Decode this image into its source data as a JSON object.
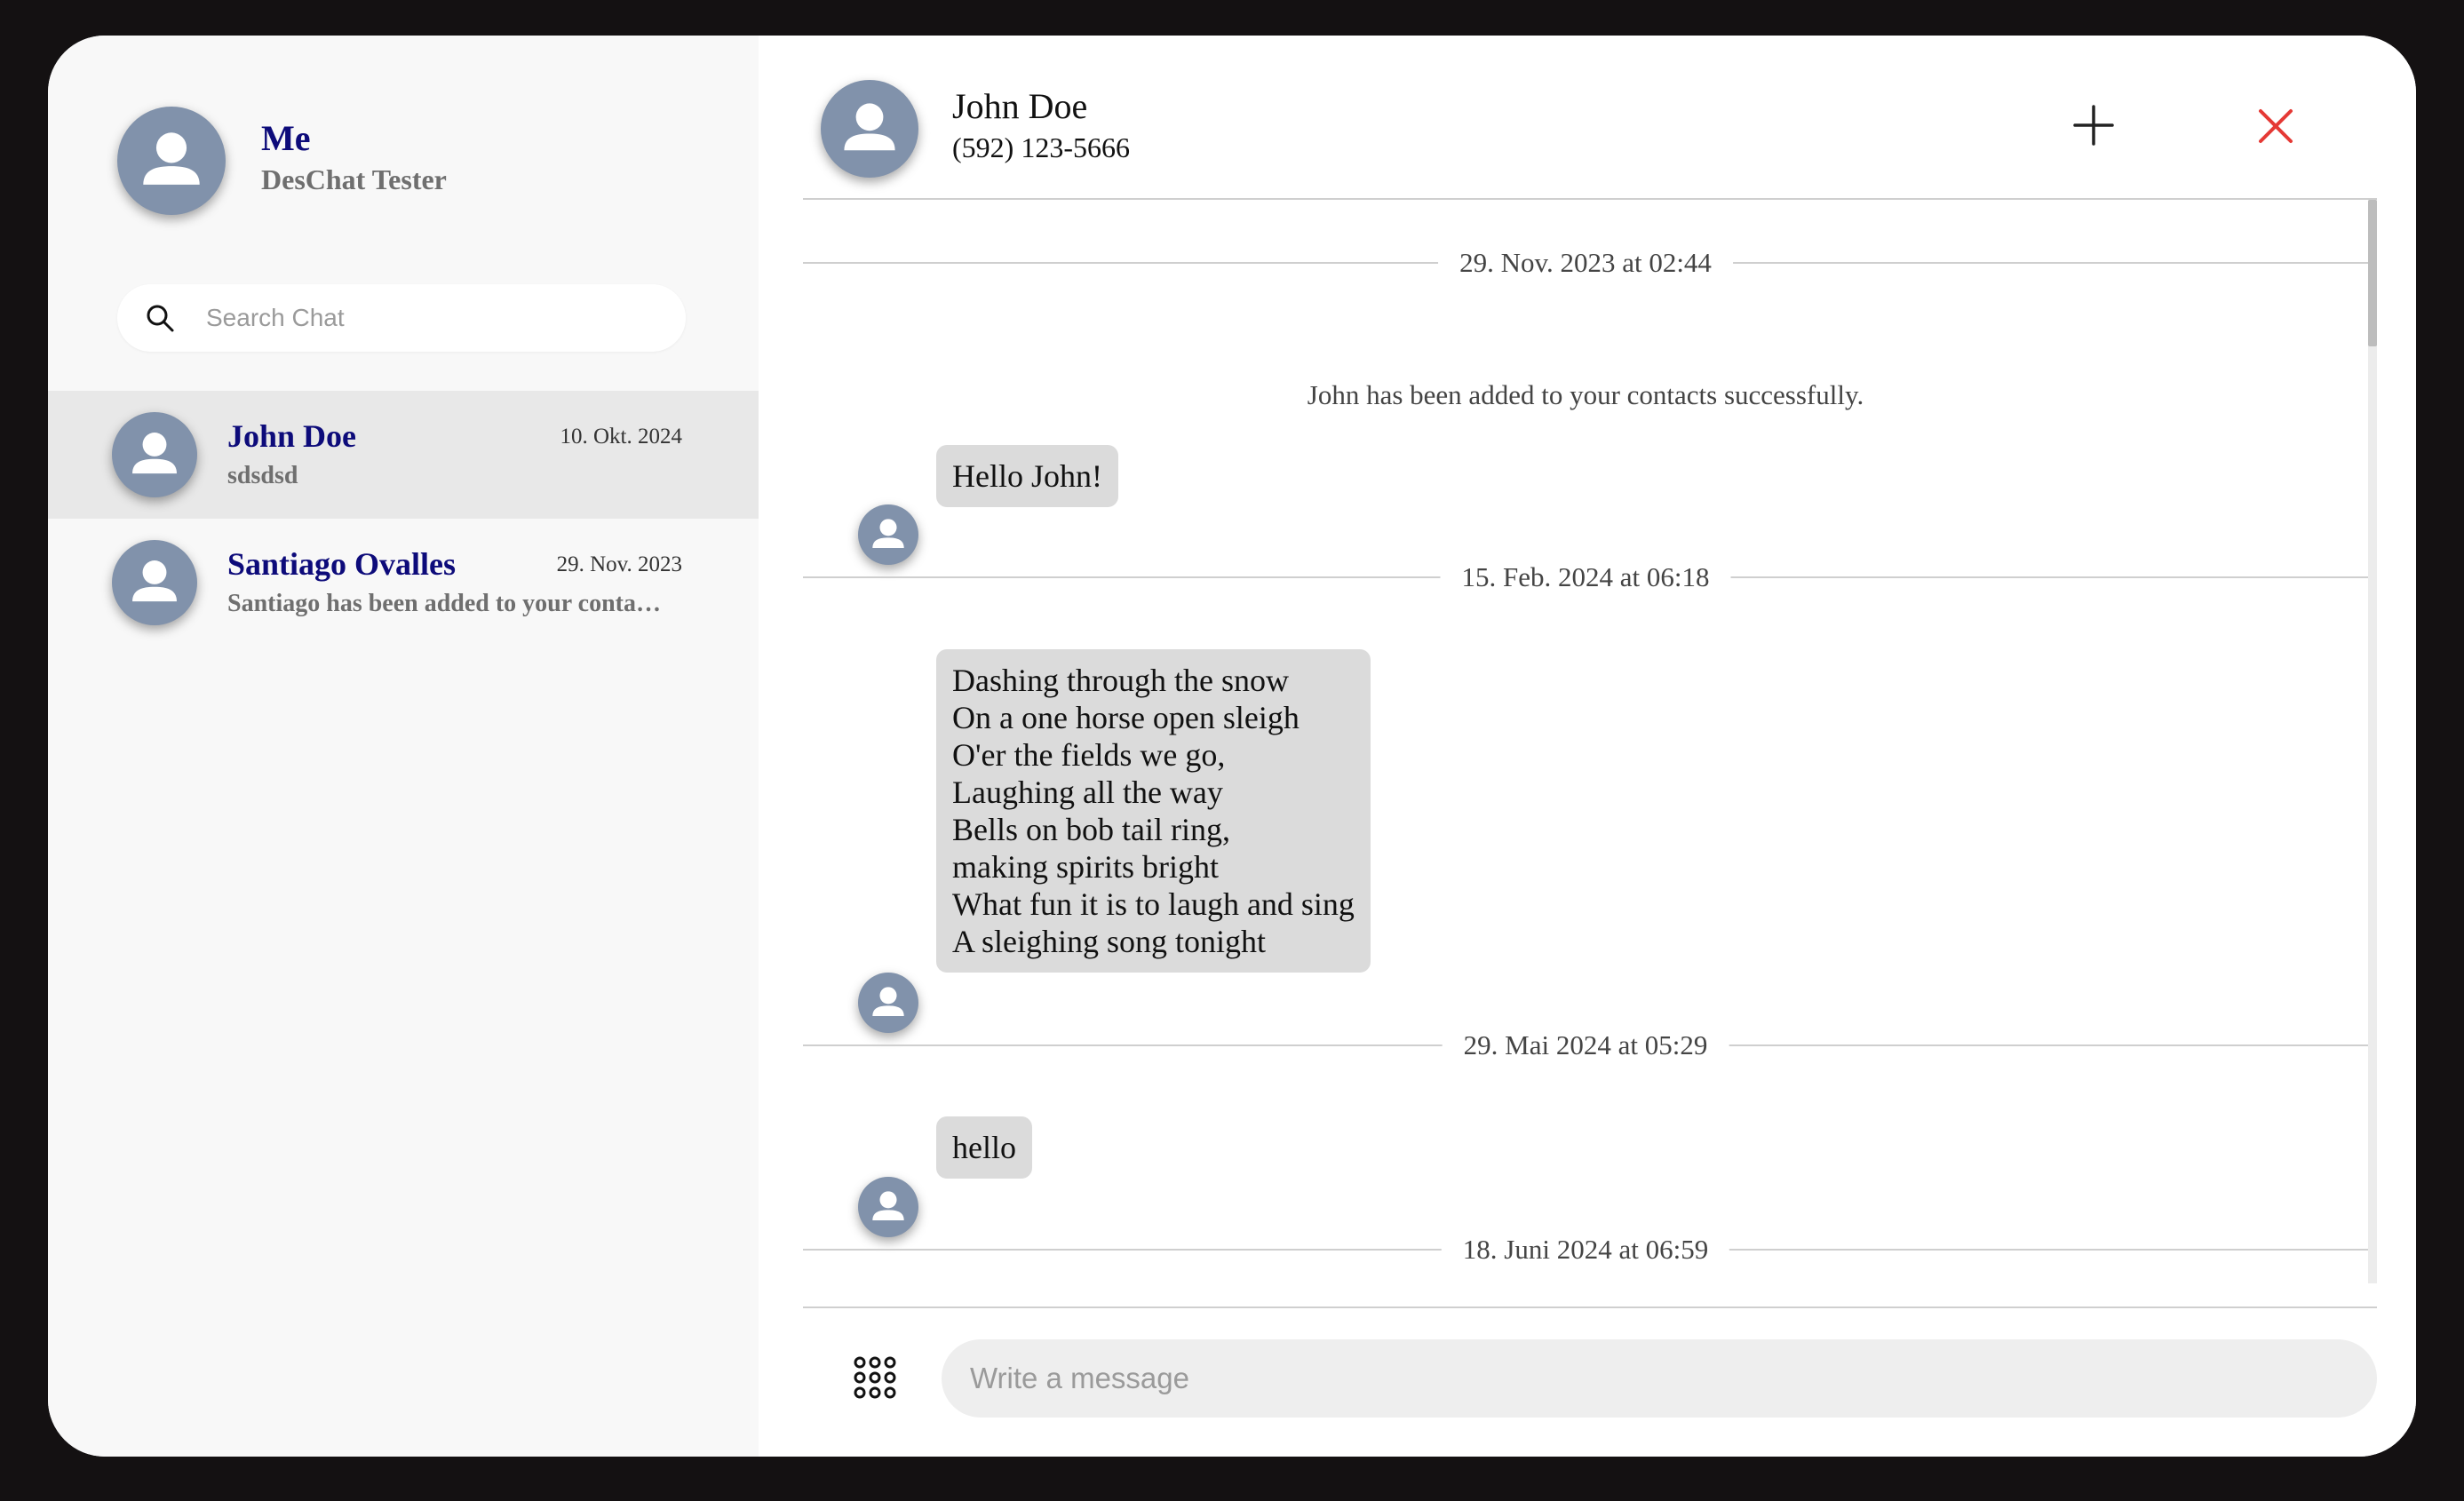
{
  "profile": {
    "name": "Me",
    "subtitle": "DesChat Tester",
    "avatar_icon": "user-icon"
  },
  "search": {
    "placeholder": "Search Chat",
    "icon": "search-icon"
  },
  "chats": [
    {
      "name": "John Doe",
      "date": "10. Okt. 2024",
      "preview": "sdsdsd",
      "active": true
    },
    {
      "name": "Santiago Ovalles",
      "date": "29. Nov. 2023",
      "preview": "Santiago has been added to your contacts successfully.",
      "active": false
    }
  ],
  "conversation": {
    "contact_name": "John Doe",
    "contact_phone": "(592) 123-5666",
    "actions": {
      "add_icon": "plus-icon",
      "close_icon": "close-icon"
    },
    "timeline": [
      {
        "type": "date",
        "label": "29. Nov. 2023 at 02:44"
      },
      {
        "type": "system",
        "text": "John has been added to your contacts successfully."
      },
      {
        "type": "message",
        "text": "Hello John!"
      },
      {
        "type": "date",
        "label": "15. Feb. 2024 at 06:18"
      },
      {
        "type": "message",
        "text": "Dashing through the snow\nOn a one horse open sleigh\nO'er the fields we go,\nLaughing all the way\nBells on bob tail ring,\nmaking spirits bright\nWhat fun it is to laugh and sing\nA sleighing song tonight"
      },
      {
        "type": "date",
        "label": "29. Mai 2024 at 05:29"
      },
      {
        "type": "message",
        "text": "hello"
      },
      {
        "type": "date",
        "label": "18. Juni 2024 at 06:59"
      }
    ]
  },
  "composer": {
    "placeholder": "Write a message",
    "apps_icon": "grid-dots-icon"
  },
  "colors": {
    "accent_name": "#0d0b7a",
    "avatar_bg": "#8192ab",
    "bubble_bg": "#dbdbdb",
    "close": "#e53935"
  }
}
